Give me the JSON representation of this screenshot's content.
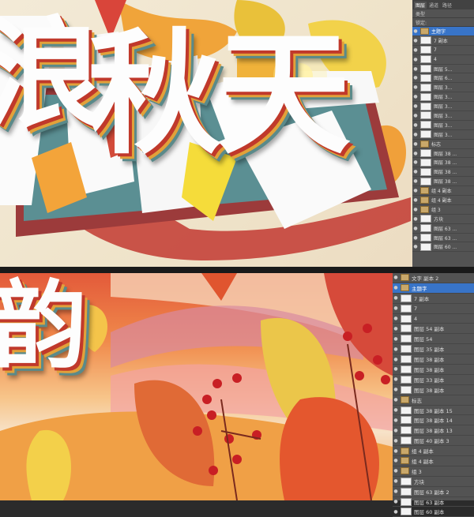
{
  "artwork": {
    "top_title": "秋天",
    "top_left_glyph": "浪",
    "bottom_glyph": "韵"
  },
  "layers_top": {
    "tabs": [
      "图层",
      "通道",
      "路径"
    ],
    "tool_label": "类型",
    "lock_label": "锁定:",
    "items": [
      {
        "label": "主题字",
        "kind": "folder",
        "selected": true
      },
      {
        "label": "7 副本",
        "kind": "layer"
      },
      {
        "label": "7",
        "kind": "layer"
      },
      {
        "label": "4",
        "kind": "layer"
      },
      {
        "label": "图层 5...",
        "kind": "layer"
      },
      {
        "label": "图层 6...",
        "kind": "layer"
      },
      {
        "label": "图层 3...",
        "kind": "layer"
      },
      {
        "label": "图层 3...",
        "kind": "layer"
      },
      {
        "label": "图层 3...",
        "kind": "layer"
      },
      {
        "label": "图层 3...",
        "kind": "layer"
      },
      {
        "label": "图层 3...",
        "kind": "layer"
      },
      {
        "label": "图层 3...",
        "kind": "layer"
      },
      {
        "label": "标志",
        "kind": "folder"
      },
      {
        "label": "图层 38 ...",
        "kind": "layer"
      },
      {
        "label": "图层 38 ...",
        "kind": "layer"
      },
      {
        "label": "图层 38 ...",
        "kind": "layer"
      },
      {
        "label": "图层 38 ...",
        "kind": "layer"
      },
      {
        "label": "组 4 副本",
        "kind": "folder"
      },
      {
        "label": "组 4 副本",
        "kind": "folder"
      },
      {
        "label": "组 3",
        "kind": "folder"
      },
      {
        "label": "方块",
        "kind": "layer"
      },
      {
        "label": "图层 63 ...",
        "kind": "layer"
      },
      {
        "label": "图层 63 ...",
        "kind": "layer"
      },
      {
        "label": "图层 60 ...",
        "kind": "layer"
      }
    ]
  },
  "layers_bottom": {
    "items": [
      {
        "label": "文字 副本 2",
        "kind": "folder"
      },
      {
        "label": "主题字",
        "kind": "folder",
        "selected": true
      },
      {
        "label": "7 副本",
        "kind": "layer"
      },
      {
        "label": "7",
        "kind": "layer"
      },
      {
        "label": "4",
        "kind": "layer"
      },
      {
        "label": "图层 54 副本",
        "kind": "layer"
      },
      {
        "label": "图层 54",
        "kind": "layer"
      },
      {
        "label": "图层 35 副本",
        "kind": "layer"
      },
      {
        "label": "图层 38 副本",
        "kind": "layer"
      },
      {
        "label": "图层 38 副本",
        "kind": "layer"
      },
      {
        "label": "图层 33 副本",
        "kind": "layer"
      },
      {
        "label": "图层 38 副本",
        "kind": "layer"
      },
      {
        "label": "标志",
        "kind": "folder"
      },
      {
        "label": "图层 38 副本 15",
        "kind": "layer"
      },
      {
        "label": "图层 38 副本 14",
        "kind": "layer"
      },
      {
        "label": "图层 38 副本 13",
        "kind": "layer"
      },
      {
        "label": "图层 40 副本 3",
        "kind": "layer"
      },
      {
        "label": "组 4 副本",
        "kind": "folder"
      },
      {
        "label": "组 4 副本",
        "kind": "folder"
      },
      {
        "label": "组 3",
        "kind": "folder"
      },
      {
        "label": "方块",
        "kind": "layer"
      },
      {
        "label": "图层 63 副本 2",
        "kind": "layer"
      },
      {
        "label": "图层 63 副本",
        "kind": "layer"
      },
      {
        "label": "图层 60 副本",
        "kind": "layer"
      }
    ]
  }
}
